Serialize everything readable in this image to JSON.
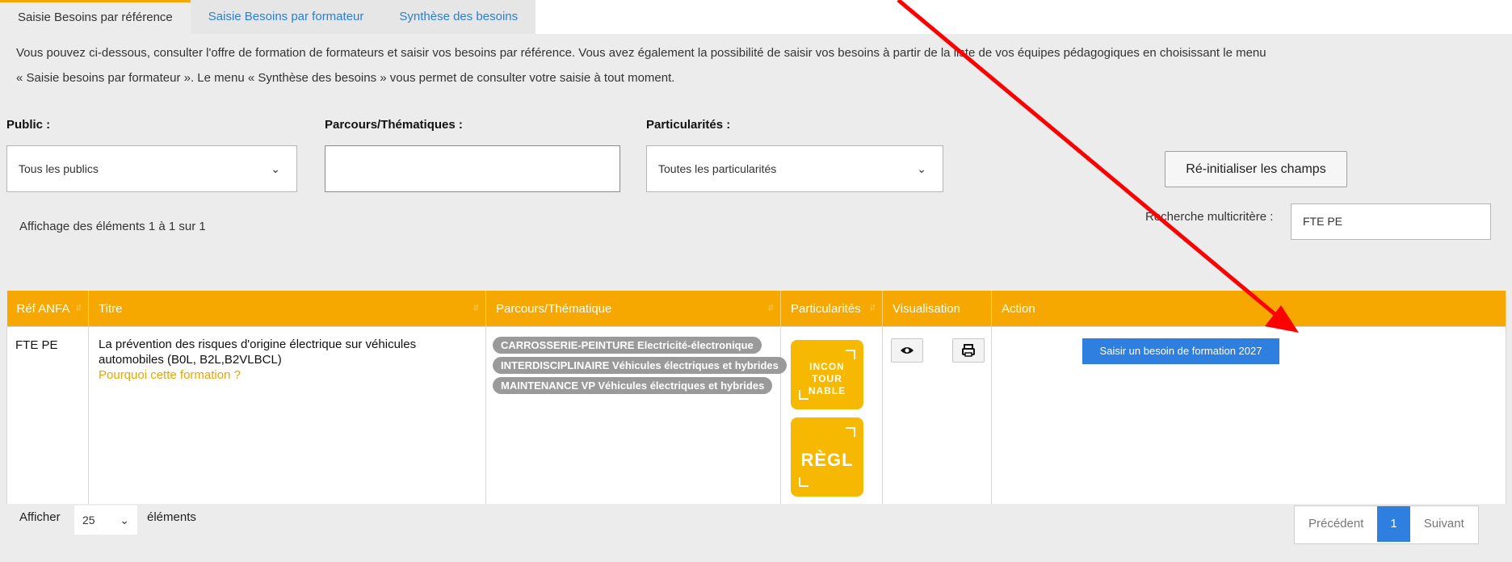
{
  "tabs": [
    {
      "label": "Saisie Besoins par référence",
      "active": true
    },
    {
      "label": "Saisie Besoins par formateur",
      "active": false
    },
    {
      "label": "Synthèse des besoins",
      "active": false
    }
  ],
  "intro": {
    "line1": "Vous pouvez ci-dessous, consulter l'offre de formation de formateurs et saisir vos besoins par référence. Vous avez également la possibilité de saisir vos besoins à partir de la liste de vos équipes pédagogiques en choisissant le menu",
    "line2": "« Saisie besoins par formateur ». Le menu « Synthèse des besoins » vous permet de consulter votre saisie à tout moment."
  },
  "filters": {
    "public": {
      "label": "Public :",
      "value": "Tous les publics"
    },
    "parcours": {
      "label": "Parcours/Thématiques :",
      "value": ""
    },
    "particularites": {
      "label": "Particularités :",
      "value": "Toutes les particularités"
    },
    "reset_label": "Ré-initialiser les champs"
  },
  "info": "Affichage des éléments 1 à 1 sur 1",
  "search": {
    "label": "Recherche multicritère :",
    "value": "FTE PE"
  },
  "table": {
    "headers": [
      "Réf ANFA",
      "Titre",
      "Parcours/Thématique",
      "Particularités",
      "Visualisation",
      "Action"
    ],
    "row": {
      "ref": "FTE PE",
      "title": "La prévention des risques d'origine électrique sur véhicules automobiles (B0L, B2L,B2VLBCL)",
      "why_link": "Pourquoi cette formation ?",
      "parcours": [
        "CARROSSERIE-PEINTURE Electricité-électronique",
        "INTERDISCIPLINAIRE Véhicules électriques et hybrides",
        "MAINTENANCE VP Véhicules électriques et hybrides"
      ],
      "badge1": [
        "INCON",
        "TOUR",
        "NABLE"
      ],
      "badge2": "RÈGL",
      "action_label": "Saisir un besoin de formation 2027"
    }
  },
  "footer": {
    "show_label": "Afficher",
    "page_length": "25",
    "elements_label": "éléments",
    "prev": "Précédent",
    "current_page": "1",
    "next": "Suivant"
  },
  "colors": {
    "accent": "#f6a800",
    "primary": "#2e7fe0",
    "annotation_arrow": "#ff0000"
  },
  "icons": [
    "eye-icon",
    "print-icon",
    "chevron-down-icon",
    "sort-icon"
  ]
}
